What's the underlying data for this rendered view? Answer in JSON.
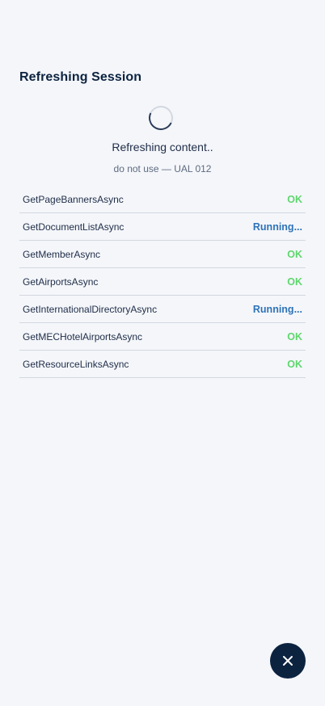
{
  "header": {
    "title": "Refreshing Session"
  },
  "progress": {
    "status": "Refreshing content..",
    "subtitle": "do not use — UAL 012"
  },
  "tasks": [
    {
      "name": "GetPageBannersAsync",
      "status": "OK",
      "state": "ok"
    },
    {
      "name": "GetDocumentListAsync",
      "status": "Running...",
      "state": "running"
    },
    {
      "name": "GetMemberAsync",
      "status": "OK",
      "state": "ok"
    },
    {
      "name": "GetAirportsAsync",
      "status": "OK",
      "state": "ok"
    },
    {
      "name": "GetInternationalDirectoryAsync",
      "status": "Running...",
      "state": "running"
    },
    {
      "name": "GetMECHotelAirportsAsync",
      "status": "OK",
      "state": "ok"
    },
    {
      "name": "GetResourceLinksAsync",
      "status": "OK",
      "state": "ok"
    }
  ],
  "colors": {
    "background": "#f4f6fa",
    "primary": "#0c2340",
    "ok": "#5fd66d",
    "running": "#2e73b8"
  },
  "icons": {
    "close": "close-icon",
    "spinner": "loading-spinner-icon"
  }
}
